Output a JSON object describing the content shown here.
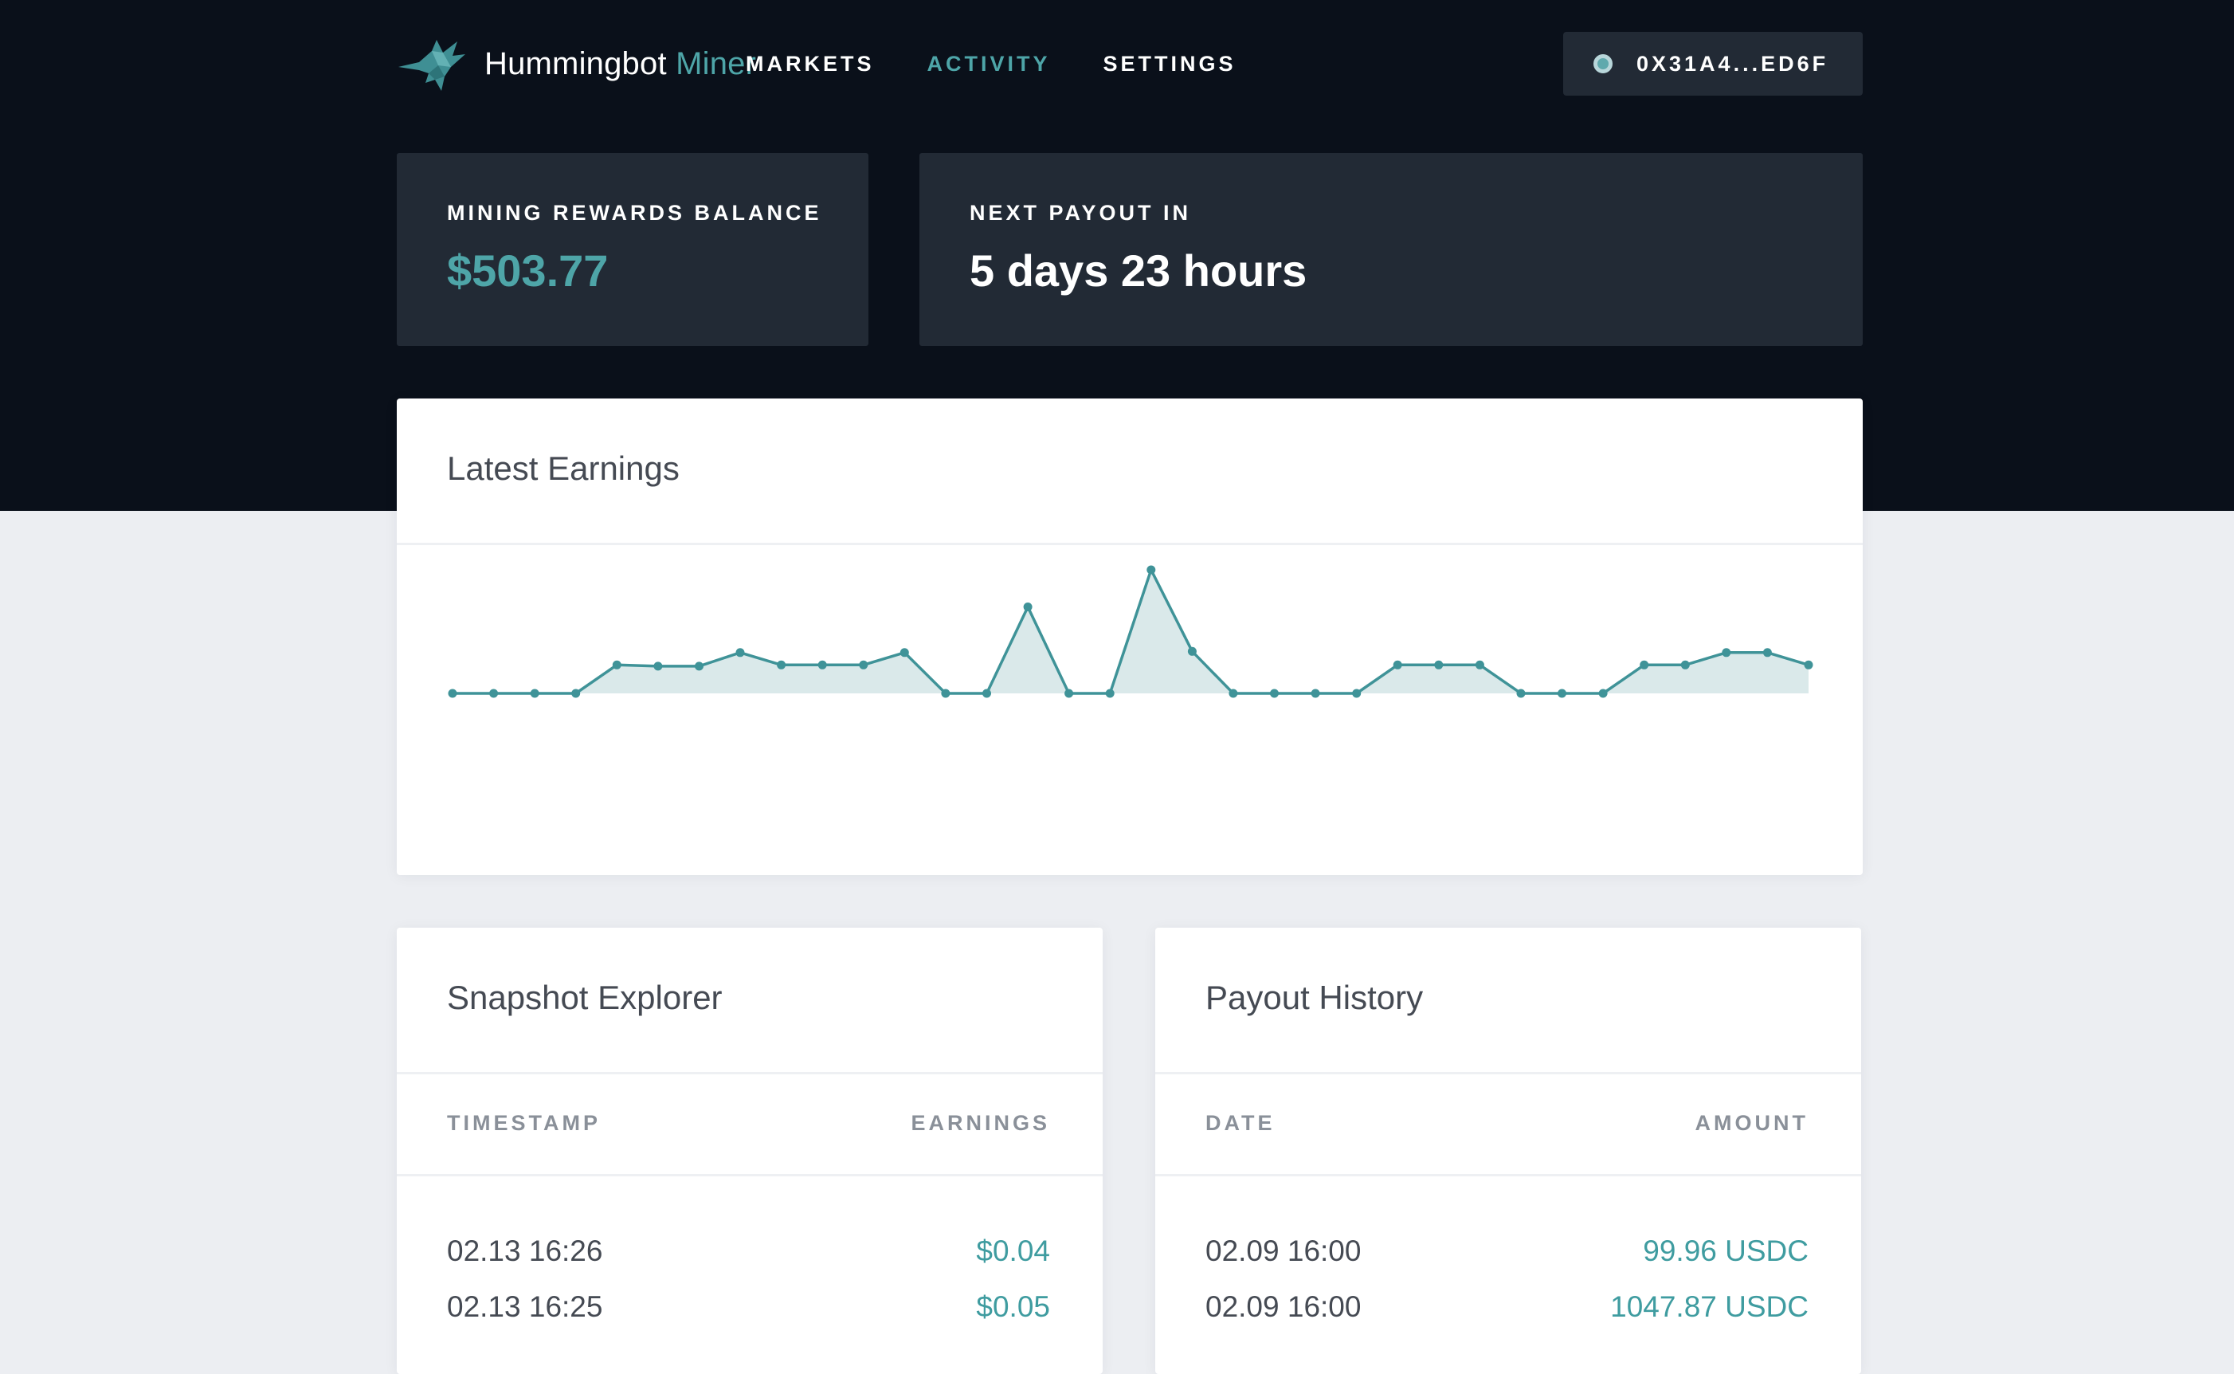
{
  "header": {
    "brand_main": "Hummingbot",
    "brand_accent": "Miner",
    "nav": [
      {
        "label": "MARKETS"
      },
      {
        "label": "ACTIVITY"
      },
      {
        "label": "SETTINGS"
      }
    ],
    "wallet": "0X31A4...ED6F"
  },
  "stats": {
    "balance_label": "MINING REWARDS BALANCE",
    "balance_value": "$503.77",
    "payout_label": "NEXT PAYOUT IN",
    "payout_value": "5 days 23 hours"
  },
  "earnings": {
    "title": "Latest Earnings"
  },
  "chart_data": {
    "type": "area",
    "title": "Latest Earnings",
    "values": [
      0,
      0,
      0,
      0,
      0.23,
      0.22,
      0.22,
      0.33,
      0.23,
      0.23,
      0.23,
      0.33,
      0,
      0,
      0.7,
      0,
      0,
      1.0,
      0.34,
      0,
      0,
      0,
      0,
      0.23,
      0.23,
      0.23,
      0,
      0,
      0,
      0.23,
      0.23,
      0.33,
      0.33,
      0.23
    ],
    "colors": {
      "line": "#3f9398",
      "fill": "#dae9ea"
    }
  },
  "snapshot": {
    "title": "Snapshot Explorer",
    "columns": [
      "TIMESTAMP",
      "EARNINGS"
    ],
    "rows": [
      [
        "02.13 16:26",
        "$0.04"
      ],
      [
        "02.13 16:25",
        "$0.05"
      ]
    ]
  },
  "payout": {
    "title": "Payout History",
    "columns": [
      "DATE",
      "AMOUNT"
    ],
    "rows": [
      [
        "02.09 16:00",
        "99.96 USDC"
      ],
      [
        "02.09 16:00",
        "1047.87 USDC"
      ]
    ]
  },
  "colors": {
    "dark_bg": "#0a101a",
    "panel": "#222a35",
    "accent": "#4ea5a8",
    "page_bg": "#eceef2"
  }
}
